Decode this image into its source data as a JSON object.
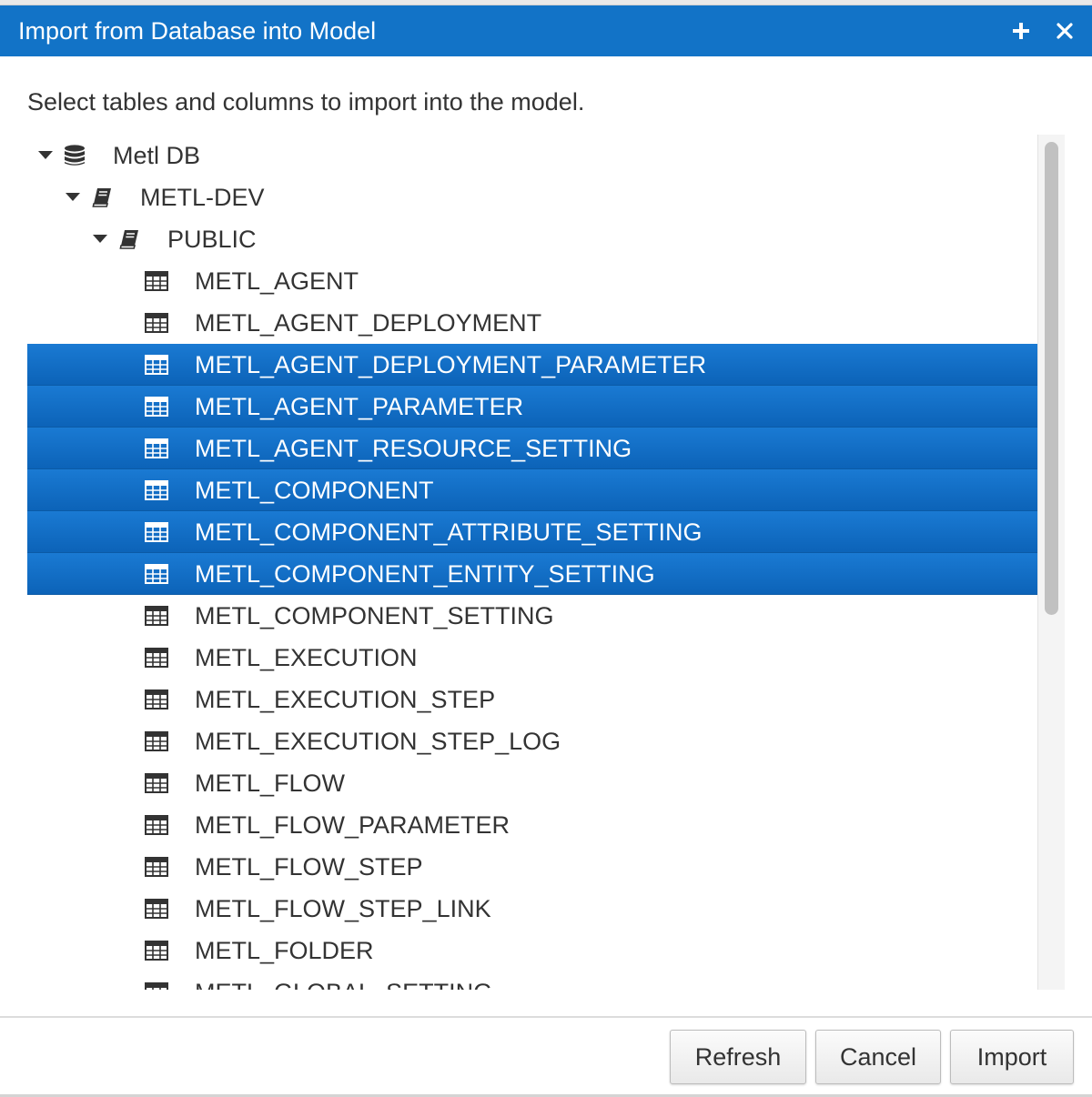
{
  "dialog": {
    "title": "Import from Database into Model",
    "instructions": "Select tables and columns to import into the model."
  },
  "colors": {
    "titlebar": "#1273c7",
    "selection": "#0c63b8",
    "text": "#333333"
  },
  "tree": {
    "rows": [
      {
        "label": "Metl DB",
        "level": 0,
        "icon": "database-icon",
        "expanded": true,
        "selected": false
      },
      {
        "label": "METL-DEV",
        "level": 1,
        "icon": "book-icon",
        "expanded": true,
        "selected": false
      },
      {
        "label": "PUBLIC",
        "level": 2,
        "icon": "book-icon",
        "expanded": true,
        "selected": false
      },
      {
        "label": "METL_AGENT",
        "level": 3,
        "icon": "table-icon",
        "selected": false
      },
      {
        "label": "METL_AGENT_DEPLOYMENT",
        "level": 3,
        "icon": "table-icon",
        "selected": false
      },
      {
        "label": "METL_AGENT_DEPLOYMENT_PARAMETER",
        "level": 3,
        "icon": "table-icon",
        "selected": true
      },
      {
        "label": "METL_AGENT_PARAMETER",
        "level": 3,
        "icon": "table-icon",
        "selected": true
      },
      {
        "label": "METL_AGENT_RESOURCE_SETTING",
        "level": 3,
        "icon": "table-icon",
        "selected": true
      },
      {
        "label": "METL_COMPONENT",
        "level": 3,
        "icon": "table-icon",
        "selected": true
      },
      {
        "label": "METL_COMPONENT_ATTRIBUTE_SETTING",
        "level": 3,
        "icon": "table-icon",
        "selected": true
      },
      {
        "label": "METL_COMPONENT_ENTITY_SETTING",
        "level": 3,
        "icon": "table-icon",
        "selected": true
      },
      {
        "label": "METL_COMPONENT_SETTING",
        "level": 3,
        "icon": "table-icon",
        "selected": false
      },
      {
        "label": "METL_EXECUTION",
        "level": 3,
        "icon": "table-icon",
        "selected": false
      },
      {
        "label": "METL_EXECUTION_STEP",
        "level": 3,
        "icon": "table-icon",
        "selected": false
      },
      {
        "label": "METL_EXECUTION_STEP_LOG",
        "level": 3,
        "icon": "table-icon",
        "selected": false
      },
      {
        "label": "METL_FLOW",
        "level": 3,
        "icon": "table-icon",
        "selected": false
      },
      {
        "label": "METL_FLOW_PARAMETER",
        "level": 3,
        "icon": "table-icon",
        "selected": false
      },
      {
        "label": "METL_FLOW_STEP",
        "level": 3,
        "icon": "table-icon",
        "selected": false
      },
      {
        "label": "METL_FLOW_STEP_LINK",
        "level": 3,
        "icon": "table-icon",
        "selected": false
      },
      {
        "label": "METL_FOLDER",
        "level": 3,
        "icon": "table-icon",
        "selected": false
      },
      {
        "label": "METL_GLOBAL_SETTING",
        "level": 3,
        "icon": "table-icon",
        "selected": false
      }
    ]
  },
  "footer": {
    "refresh_label": "Refresh",
    "cancel_label": "Cancel",
    "import_label": "Import"
  }
}
